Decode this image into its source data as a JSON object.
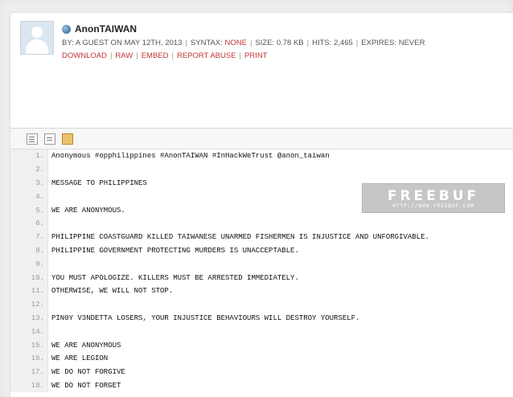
{
  "paste": {
    "title": "AnonTAIWAN",
    "by": "BY: A GUEST ON MAY 12TH, 2013",
    "syntax_label": "SYNTAX:",
    "syntax_value": "NONE",
    "size": "SIZE: 0.78 KB",
    "hits": "HITS: 2,465",
    "expires": "EXPIRES: NEVER",
    "separator": "|"
  },
  "actions": {
    "download": "DOWNLOAD",
    "raw": "RAW",
    "embed": "EMBED",
    "report_abuse": "REPORT ABUSE",
    "print": "PRINT"
  },
  "watermark": {
    "title": "FREEBUF",
    "url": "HTTP://WWW.FREEBUF.COM"
  },
  "icons": {
    "avatar": "user-avatar-placeholder",
    "title_icon": "globe-icon",
    "toolbar": [
      "line-numbers-icon",
      "plain-text-icon",
      "copy-icon"
    ]
  },
  "colors": {
    "link": "#c03535",
    "gutter_bg": "#f0f0f0"
  },
  "code_lines": [
    {
      "num": "1.",
      "text": "Anonymous #opphilippines #AnonTAIWAN #InHackWeTrust @anon_taiwan"
    },
    {
      "num": "2.",
      "text": ""
    },
    {
      "num": "3.",
      "text": "MESSAGE TO PHILIPPINES"
    },
    {
      "num": "4.",
      "text": ""
    },
    {
      "num": "5.",
      "text": "WE ARE ANONYMOUS."
    },
    {
      "num": "6.",
      "text": ""
    },
    {
      "num": "7.",
      "text": "PHILIPPINE COASTGUARD KILLED TAIWANESE UNARMED FISHERMEN IS INJUSTICE AND UNFORGIVABLE."
    },
    {
      "num": "8.",
      "text": "PHILIPPINE GOVERNMENT PROTECTING MURDERS IS UNACCEPTABLE."
    },
    {
      "num": "9.",
      "text": ""
    },
    {
      "num": "10.",
      "text": "YOU MUST APOLOGIZE. KILLERS MUST BE ARRESTED IMMEDIATELY."
    },
    {
      "num": "11.",
      "text": "OTHERWISE, WE WILL NOT STOP."
    },
    {
      "num": "12.",
      "text": ""
    },
    {
      "num": "13.",
      "text": "PIN0Y V3NDETTA LOSERS, YOUR INJUSTICE BEHAVIOURS WILL DESTROY YOURSELF."
    },
    {
      "num": "14.",
      "text": ""
    },
    {
      "num": "15.",
      "text": "WE ARE ANONYMOUS"
    },
    {
      "num": "16.",
      "text": "WE ARE LEGION"
    },
    {
      "num": "17.",
      "text": "WE DO NOT FORGIVE"
    },
    {
      "num": "18.",
      "text": "WE DO NOT FORGET"
    }
  ]
}
